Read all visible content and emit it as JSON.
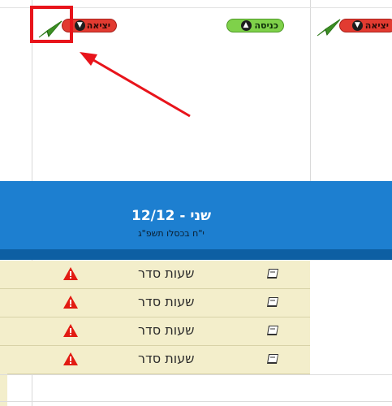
{
  "header": {
    "exit_label": "יציאה",
    "enter_label": "כניסה",
    "exit_label_right": "יציאה"
  },
  "day": {
    "title": "שני - 12/12",
    "subtitle": "י\"ח בכסלו תשפ\"ג"
  },
  "rows": [
    {
      "label": "שעות סדר"
    },
    {
      "label": "שעות סדר"
    },
    {
      "label": "שעות סדר"
    },
    {
      "label": "שעות סדר"
    }
  ],
  "colors": {
    "header_blue": "#1d7fd0",
    "row_bg": "#f3eecb",
    "exit_pill": "#e23b31",
    "enter_pill": "#7fd14a",
    "annotation": "#e8141b"
  },
  "icons": [
    "paper-plane-icon",
    "arrow-down-icon",
    "arrow-up-icon",
    "warning-icon",
    "book-icon"
  ]
}
